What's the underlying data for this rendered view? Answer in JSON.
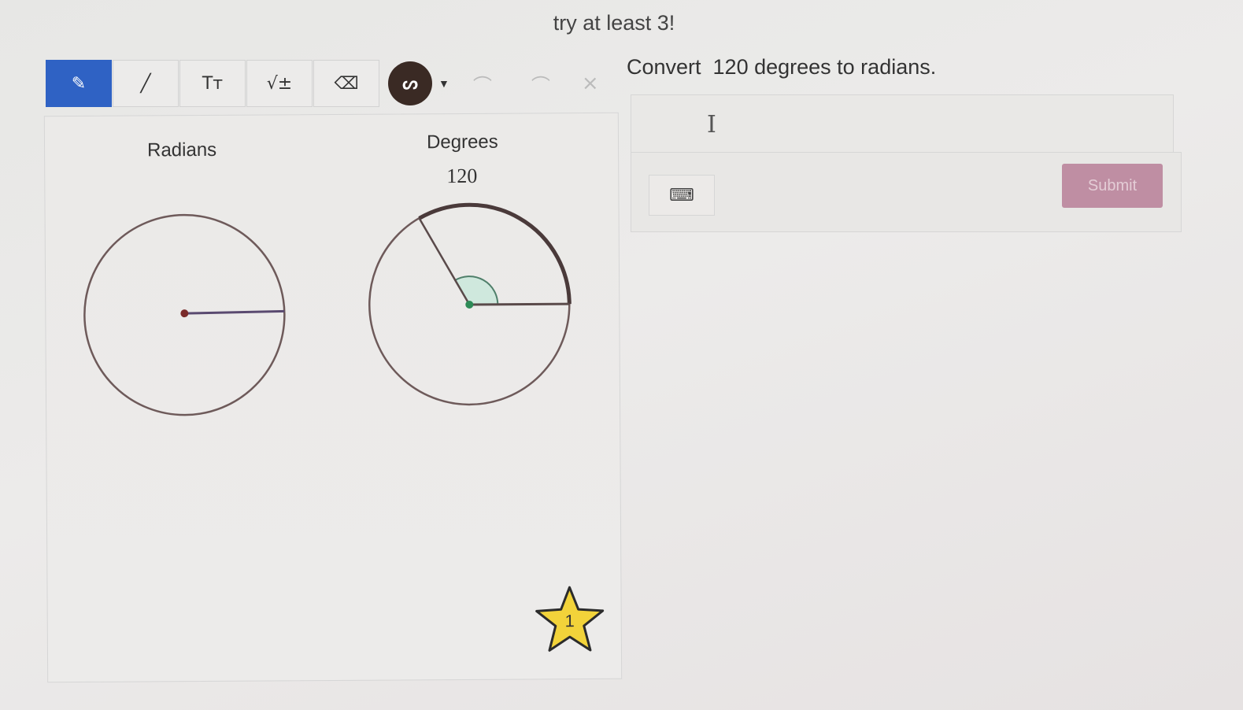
{
  "header": {
    "note": "try at least 3!"
  },
  "toolbar": {
    "tools": [
      {
        "icon": "pencil-icon",
        "glyph": "✎",
        "active": true
      },
      {
        "icon": "line-icon",
        "glyph": "╱",
        "active": false
      },
      {
        "icon": "text-size-icon",
        "glyph": "Tт",
        "active": false
      },
      {
        "icon": "math-icon",
        "glyph": "√±",
        "active": false
      },
      {
        "icon": "eraser-icon",
        "glyph": "⌫",
        "active": false
      }
    ],
    "color": {
      "value": "#3a2a24",
      "glyph": "ᔕ"
    },
    "caret_glyph": "▼",
    "undo_glyph": "⌒",
    "redo_glyph": "⌒",
    "clear_glyph": "×"
  },
  "canvas": {
    "radians_label": "Radians",
    "degrees_label": "Degrees",
    "degrees_value": "120",
    "star_count": "1"
  },
  "question": {
    "prompt": "Convert  120 degrees to radians.",
    "answer_value": "",
    "cursor_glyph": "I",
    "keyboard_glyph": "⌨",
    "submit_label": "Submit"
  },
  "colors": {
    "accent": "#2f62c4",
    "submit": "#bf8ea3",
    "angle_fill": "#cfe8dd",
    "center_dot": "#2e8b57",
    "radius_line": "#5a4a70"
  }
}
